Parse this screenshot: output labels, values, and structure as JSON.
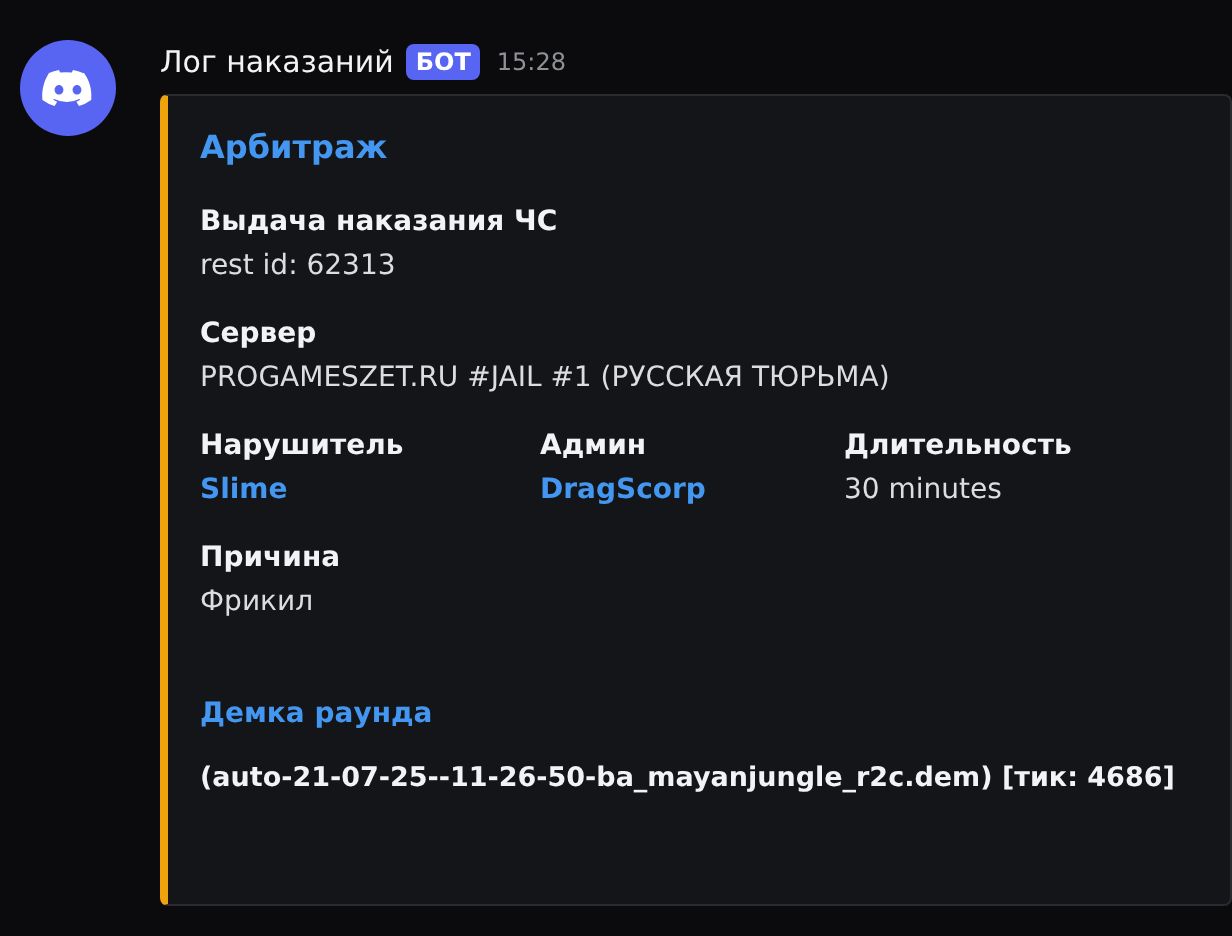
{
  "message": {
    "author": "Лог наказаний",
    "badge": "БОТ",
    "time": "15:28"
  },
  "embed": {
    "color": "#f0a30a",
    "title": "Арбитраж",
    "field_rows": [
      [
        {
          "name": "Выдача наказания ЧС",
          "value": "rest id: 62313",
          "kind": "text"
        }
      ],
      [
        {
          "name": "Сервер",
          "value": "PROGAMESZET.RU #JAIL #1 (РУССКАЯ ТЮРЬМА)",
          "kind": "text"
        }
      ],
      [
        {
          "name": "Нарушитель",
          "value": "Slime",
          "kind": "link"
        },
        {
          "name": "Админ",
          "value": "DragScorp",
          "kind": "link"
        },
        {
          "name": "Длительность",
          "value": "30 minutes",
          "kind": "text"
        }
      ],
      [
        {
          "name": "Причина",
          "value": "Фрикил",
          "kind": "text"
        }
      ]
    ],
    "demo": {
      "title": "Демка раунда",
      "value": "(auto-21-07-25--11-26-50-ba_mayanjungle_r2c.dem) [тик: 4686]"
    }
  }
}
